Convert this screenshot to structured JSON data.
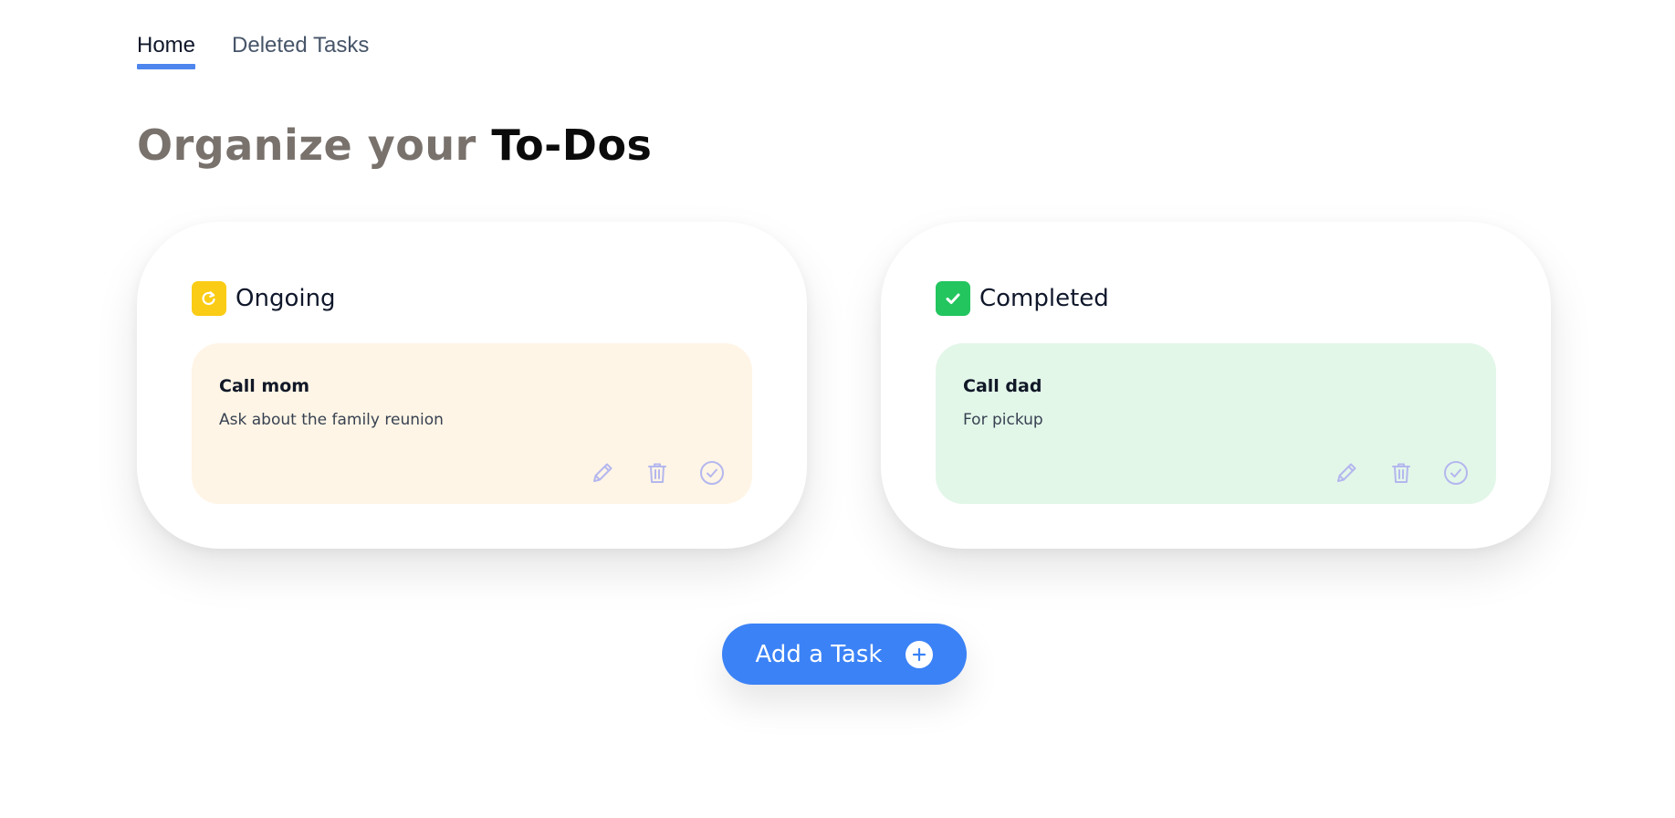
{
  "nav": {
    "tabs": [
      {
        "label": "Home",
        "active": true
      },
      {
        "label": "Deleted Tasks",
        "active": false
      }
    ]
  },
  "heading": {
    "prefix": "Organize your",
    "highlight": "To-Dos"
  },
  "panels": {
    "ongoing": {
      "title": "Ongoing",
      "icon": "refresh-icon",
      "icon_color": "#facc15",
      "card_color": "#fff5e6",
      "tasks": [
        {
          "title": "Call mom",
          "description": "Ask about the family reunion"
        }
      ]
    },
    "completed": {
      "title": "Completed",
      "icon": "check-icon",
      "icon_color": "#22c55e",
      "card_color": "#e3f7e9",
      "tasks": [
        {
          "title": "Call dad",
          "description": "For pickup"
        }
      ]
    }
  },
  "actions": {
    "icons": [
      "pencil-icon",
      "trash-icon",
      "check-circle-icon"
    ],
    "icon_color": "#b4b7ee"
  },
  "add_button": {
    "label": "Add a Task",
    "icon": "plus-circle-icon",
    "color": "#3b82f6"
  }
}
